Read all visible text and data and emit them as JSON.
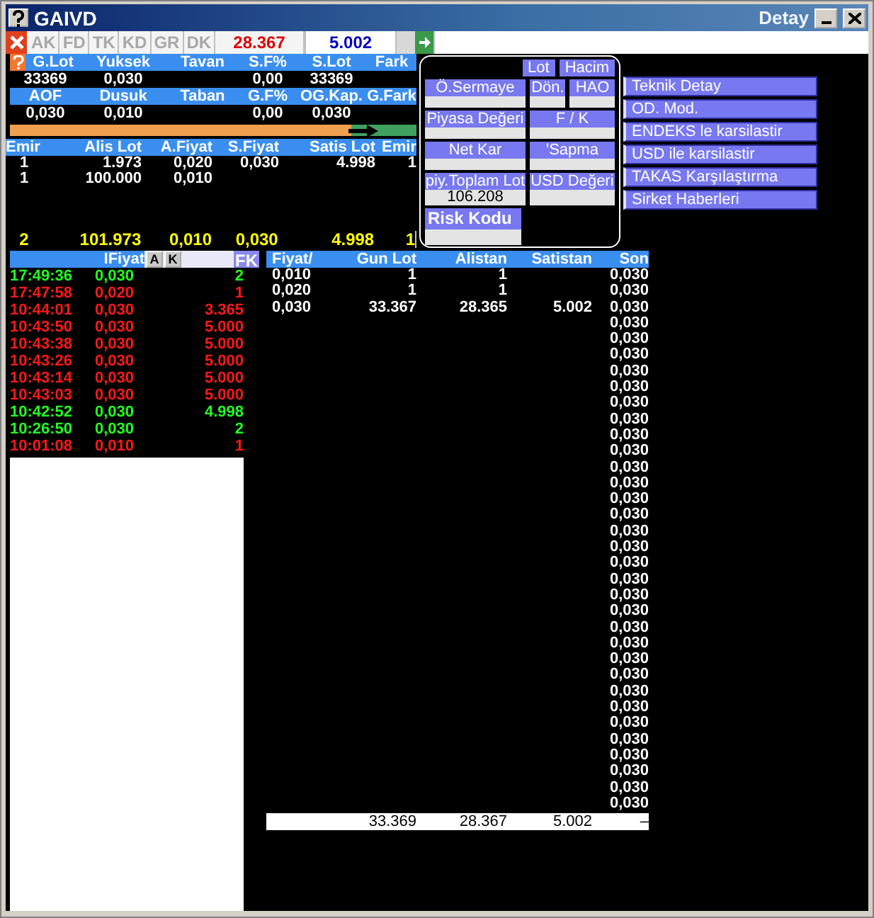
{
  "window": {
    "title": "GAIVD",
    "subtitle": "Detay"
  },
  "toolbar": {
    "tabs": [
      "AK",
      "FD",
      "TK",
      "KD",
      "GR",
      "DK"
    ],
    "bid_total": "28.367",
    "ask_total": "5.002"
  },
  "summary_rows": [
    [
      {
        "label": "G.Lot",
        "value": "33369"
      },
      {
        "label": "Yuksek",
        "value": "0,030"
      },
      {
        "label": "Tavan"
      },
      {
        "label": "S.F%",
        "value": "0,00"
      },
      {
        "label": "S.Lot",
        "value": "33369"
      },
      {
        "label": "Fark"
      }
    ],
    [
      {
        "label": "AOF",
        "value": "0,030"
      },
      {
        "label": "Dusuk",
        "value": "0,010"
      },
      {
        "label": "Taban"
      },
      {
        "label": "G.F%",
        "value": "0,00"
      },
      {
        "label": "OG.Kap.",
        "value": "0,030"
      },
      {
        "label": "G.Fark"
      }
    ]
  ],
  "balance_bar": {
    "level": 0.84
  },
  "order_book": {
    "columns": [
      "Emir",
      "Alis Lot",
      "A.Fiyat",
      "S.Fiyat",
      "Satis Lot",
      "Emir"
    ],
    "rows": [
      {
        "bid_orders": "1",
        "bid_lot": "1.973",
        "bid_price": "0,020",
        "ask_price": "0,030",
        "ask_lot": "4.998",
        "ask_orders": "1"
      },
      {
        "bid_orders": "1",
        "bid_lot": "100.000",
        "bid_price": "0,010"
      }
    ],
    "totals": {
      "bid_orders": "2",
      "bid_lot": "101.973",
      "bid_price": "0,010",
      "ask_price": "0,030",
      "ask_lot": "4.998",
      "ask_orders": "1"
    }
  },
  "info_panel": {
    "units": [
      "Lot",
      "Hacim"
    ],
    "rows": [
      [
        {
          "label": "Ö.Sermaye"
        },
        {
          "label": "Dön."
        },
        {
          "label": "HAO"
        }
      ],
      [
        {
          "label": "Piyasa Değeri"
        },
        {
          "label": "F / K"
        }
      ],
      [
        {
          "label": "Net Kar"
        },
        {
          "label": "'Sapma"
        }
      ],
      [
        {
          "label": "piy.Toplam Lot",
          "value": "106.208"
        },
        {
          "label": "USD Değeri"
        }
      ],
      [
        {
          "label": "Risk Kodu"
        }
      ]
    ]
  },
  "actions": [
    "Teknik Detay",
    "OD. Mod.",
    "ENDEKS le karsilastir",
    "USD ile karsilastir",
    "TAKAS Karşılaştırma",
    "Sirket Haberleri"
  ],
  "trades": {
    "header": "IFiyat",
    "buttons": [
      "A",
      "K"
    ],
    "filter_button": "FK",
    "rows": [
      {
        "time": "17:49:36",
        "price": "0,030",
        "lot": "2",
        "color": "#20ff20"
      },
      {
        "time": "17:47:58",
        "price": "0,020",
        "lot": "1",
        "color": "#ff1818"
      },
      {
        "time": "10:44:01",
        "price": "0,030",
        "lot": "3.365",
        "color": "#ff1818"
      },
      {
        "time": "10:43:50",
        "price": "0,030",
        "lot": "5.000",
        "color": "#ff1818"
      },
      {
        "time": "10:43:38",
        "price": "0,030",
        "lot": "5.000",
        "color": "#ff1818"
      },
      {
        "time": "10:43:26",
        "price": "0,030",
        "lot": "5.000",
        "color": "#ff1818"
      },
      {
        "time": "10:43:14",
        "price": "0,030",
        "lot": "5.000",
        "color": "#ff1818"
      },
      {
        "time": "10:43:03",
        "price": "0,030",
        "lot": "5.000",
        "color": "#ff1818"
      },
      {
        "time": "10:42:52",
        "price": "0,030",
        "lot": "4.998",
        "color": "#20ff20"
      },
      {
        "time": "10:26:50",
        "price": "0,030",
        "lot": "2",
        "color": "#20ff20"
      },
      {
        "time": "10:01:08",
        "price": "0,010",
        "lot": "1",
        "color": "#ff1818"
      }
    ]
  },
  "price_table": {
    "columns": [
      "Fiyat/",
      "Gun Lot",
      "Alistan",
      "Satistan",
      "Son"
    ],
    "rows": [
      {
        "fiyat": "0,010",
        "gun_lot": "1",
        "alistan": "1",
        "son": "0,030"
      },
      {
        "fiyat": "0,020",
        "gun_lot": "1",
        "alistan": "1",
        "son": "0,030"
      },
      {
        "fiyat": "0,030",
        "gun_lot": "33.367",
        "alistan": "28.365",
        "satistan": "5.002",
        "son": "0,030"
      },
      {
        "son": "0,030"
      },
      {
        "son": "0,030"
      },
      {
        "son": "0,030"
      },
      {
        "son": "0,030"
      },
      {
        "son": "0,030"
      },
      {
        "son": "0,030"
      },
      {
        "son": "0,030"
      },
      {
        "son": "0,030"
      },
      {
        "son": "0,030"
      },
      {
        "son": "0,030"
      },
      {
        "son": "0,030"
      },
      {
        "son": "0,030"
      },
      {
        "son": "0,030"
      },
      {
        "son": "0,030"
      },
      {
        "son": "0,030"
      },
      {
        "son": "0,030"
      },
      {
        "son": "0,030"
      },
      {
        "son": "0,030"
      },
      {
        "son": "0,030"
      },
      {
        "son": "0,030"
      },
      {
        "son": "0,030"
      },
      {
        "son": "0,030"
      },
      {
        "son": "0,030"
      },
      {
        "son": "0,030"
      },
      {
        "son": "0,030"
      },
      {
        "son": "0,030"
      },
      {
        "son": "0,030"
      },
      {
        "son": "0,030"
      },
      {
        "son": "0,030"
      },
      {
        "son": "0,030"
      },
      {
        "son": "0,030"
      }
    ],
    "totals": {
      "gun_lot": "33.369",
      "alistan": "28.367",
      "satistan": "5.002",
      "son": "–"
    }
  }
}
